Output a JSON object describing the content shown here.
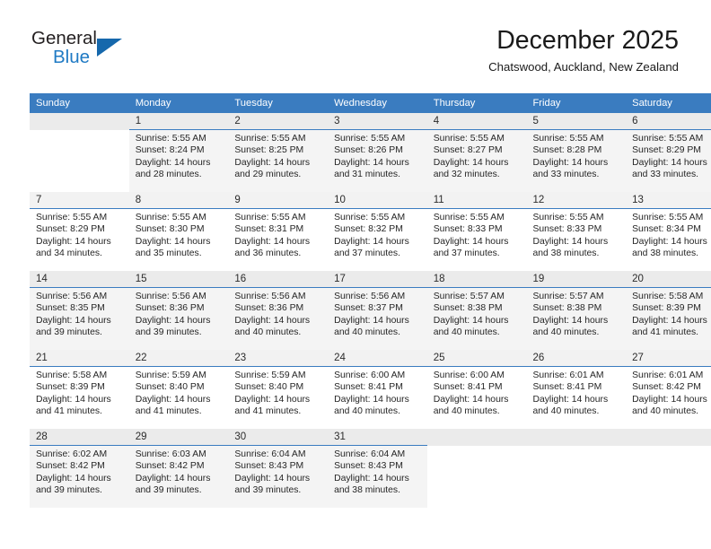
{
  "brand": {
    "word1": "General",
    "word2": "Blue",
    "triangle_color": "#1668ac",
    "blue_color": "#1f7ac4"
  },
  "header": {
    "title": "December 2025",
    "subtitle": "Chatswood, Auckland, New Zealand"
  },
  "theme": {
    "header_bar": "#3a7cc0",
    "band_row": "#f4f4f4",
    "daynum_bg": "#f2f2f2",
    "text": "#262626"
  },
  "weekdays": [
    "Sunday",
    "Monday",
    "Tuesday",
    "Wednesday",
    "Thursday",
    "Friday",
    "Saturday"
  ],
  "weeks": [
    [
      {
        "day": "",
        "sunrise": "",
        "sunset": "",
        "daylight1": "",
        "daylight2": ""
      },
      {
        "day": "1",
        "sunrise": "Sunrise: 5:55 AM",
        "sunset": "Sunset: 8:24 PM",
        "daylight1": "Daylight: 14 hours",
        "daylight2": "and 28 minutes."
      },
      {
        "day": "2",
        "sunrise": "Sunrise: 5:55 AM",
        "sunset": "Sunset: 8:25 PM",
        "daylight1": "Daylight: 14 hours",
        "daylight2": "and 29 minutes."
      },
      {
        "day": "3",
        "sunrise": "Sunrise: 5:55 AM",
        "sunset": "Sunset: 8:26 PM",
        "daylight1": "Daylight: 14 hours",
        "daylight2": "and 31 minutes."
      },
      {
        "day": "4",
        "sunrise": "Sunrise: 5:55 AM",
        "sunset": "Sunset: 8:27 PM",
        "daylight1": "Daylight: 14 hours",
        "daylight2": "and 32 minutes."
      },
      {
        "day": "5",
        "sunrise": "Sunrise: 5:55 AM",
        "sunset": "Sunset: 8:28 PM",
        "daylight1": "Daylight: 14 hours",
        "daylight2": "and 33 minutes."
      },
      {
        "day": "6",
        "sunrise": "Sunrise: 5:55 AM",
        "sunset": "Sunset: 8:29 PM",
        "daylight1": "Daylight: 14 hours",
        "daylight2": "and 33 minutes."
      }
    ],
    [
      {
        "day": "7",
        "sunrise": "Sunrise: 5:55 AM",
        "sunset": "Sunset: 8:29 PM",
        "daylight1": "Daylight: 14 hours",
        "daylight2": "and 34 minutes."
      },
      {
        "day": "8",
        "sunrise": "Sunrise: 5:55 AM",
        "sunset": "Sunset: 8:30 PM",
        "daylight1": "Daylight: 14 hours",
        "daylight2": "and 35 minutes."
      },
      {
        "day": "9",
        "sunrise": "Sunrise: 5:55 AM",
        "sunset": "Sunset: 8:31 PM",
        "daylight1": "Daylight: 14 hours",
        "daylight2": "and 36 minutes."
      },
      {
        "day": "10",
        "sunrise": "Sunrise: 5:55 AM",
        "sunset": "Sunset: 8:32 PM",
        "daylight1": "Daylight: 14 hours",
        "daylight2": "and 37 minutes."
      },
      {
        "day": "11",
        "sunrise": "Sunrise: 5:55 AM",
        "sunset": "Sunset: 8:33 PM",
        "daylight1": "Daylight: 14 hours",
        "daylight2": "and 37 minutes."
      },
      {
        "day": "12",
        "sunrise": "Sunrise: 5:55 AM",
        "sunset": "Sunset: 8:33 PM",
        "daylight1": "Daylight: 14 hours",
        "daylight2": "and 38 minutes."
      },
      {
        "day": "13",
        "sunrise": "Sunrise: 5:55 AM",
        "sunset": "Sunset: 8:34 PM",
        "daylight1": "Daylight: 14 hours",
        "daylight2": "and 38 minutes."
      }
    ],
    [
      {
        "day": "14",
        "sunrise": "Sunrise: 5:56 AM",
        "sunset": "Sunset: 8:35 PM",
        "daylight1": "Daylight: 14 hours",
        "daylight2": "and 39 minutes."
      },
      {
        "day": "15",
        "sunrise": "Sunrise: 5:56 AM",
        "sunset": "Sunset: 8:36 PM",
        "daylight1": "Daylight: 14 hours",
        "daylight2": "and 39 minutes."
      },
      {
        "day": "16",
        "sunrise": "Sunrise: 5:56 AM",
        "sunset": "Sunset: 8:36 PM",
        "daylight1": "Daylight: 14 hours",
        "daylight2": "and 40 minutes."
      },
      {
        "day": "17",
        "sunrise": "Sunrise: 5:56 AM",
        "sunset": "Sunset: 8:37 PM",
        "daylight1": "Daylight: 14 hours",
        "daylight2": "and 40 minutes."
      },
      {
        "day": "18",
        "sunrise": "Sunrise: 5:57 AM",
        "sunset": "Sunset: 8:38 PM",
        "daylight1": "Daylight: 14 hours",
        "daylight2": "and 40 minutes."
      },
      {
        "day": "19",
        "sunrise": "Sunrise: 5:57 AM",
        "sunset": "Sunset: 8:38 PM",
        "daylight1": "Daylight: 14 hours",
        "daylight2": "and 40 minutes."
      },
      {
        "day": "20",
        "sunrise": "Sunrise: 5:58 AM",
        "sunset": "Sunset: 8:39 PM",
        "daylight1": "Daylight: 14 hours",
        "daylight2": "and 41 minutes."
      }
    ],
    [
      {
        "day": "21",
        "sunrise": "Sunrise: 5:58 AM",
        "sunset": "Sunset: 8:39 PM",
        "daylight1": "Daylight: 14 hours",
        "daylight2": "and 41 minutes."
      },
      {
        "day": "22",
        "sunrise": "Sunrise: 5:59 AM",
        "sunset": "Sunset: 8:40 PM",
        "daylight1": "Daylight: 14 hours",
        "daylight2": "and 41 minutes."
      },
      {
        "day": "23",
        "sunrise": "Sunrise: 5:59 AM",
        "sunset": "Sunset: 8:40 PM",
        "daylight1": "Daylight: 14 hours",
        "daylight2": "and 41 minutes."
      },
      {
        "day": "24",
        "sunrise": "Sunrise: 6:00 AM",
        "sunset": "Sunset: 8:41 PM",
        "daylight1": "Daylight: 14 hours",
        "daylight2": "and 40 minutes."
      },
      {
        "day": "25",
        "sunrise": "Sunrise: 6:00 AM",
        "sunset": "Sunset: 8:41 PM",
        "daylight1": "Daylight: 14 hours",
        "daylight2": "and 40 minutes."
      },
      {
        "day": "26",
        "sunrise": "Sunrise: 6:01 AM",
        "sunset": "Sunset: 8:41 PM",
        "daylight1": "Daylight: 14 hours",
        "daylight2": "and 40 minutes."
      },
      {
        "day": "27",
        "sunrise": "Sunrise: 6:01 AM",
        "sunset": "Sunset: 8:42 PM",
        "daylight1": "Daylight: 14 hours",
        "daylight2": "and 40 minutes."
      }
    ],
    [
      {
        "day": "28",
        "sunrise": "Sunrise: 6:02 AM",
        "sunset": "Sunset: 8:42 PM",
        "daylight1": "Daylight: 14 hours",
        "daylight2": "and 39 minutes."
      },
      {
        "day": "29",
        "sunrise": "Sunrise: 6:03 AM",
        "sunset": "Sunset: 8:42 PM",
        "daylight1": "Daylight: 14 hours",
        "daylight2": "and 39 minutes."
      },
      {
        "day": "30",
        "sunrise": "Sunrise: 6:04 AM",
        "sunset": "Sunset: 8:43 PM",
        "daylight1": "Daylight: 14 hours",
        "daylight2": "and 39 minutes."
      },
      {
        "day": "31",
        "sunrise": "Sunrise: 6:04 AM",
        "sunset": "Sunset: 8:43 PM",
        "daylight1": "Daylight: 14 hours",
        "daylight2": "and 38 minutes."
      },
      {
        "day": "",
        "sunrise": "",
        "sunset": "",
        "daylight1": "",
        "daylight2": ""
      },
      {
        "day": "",
        "sunrise": "",
        "sunset": "",
        "daylight1": "",
        "daylight2": ""
      },
      {
        "day": "",
        "sunrise": "",
        "sunset": "",
        "daylight1": "",
        "daylight2": ""
      }
    ]
  ]
}
